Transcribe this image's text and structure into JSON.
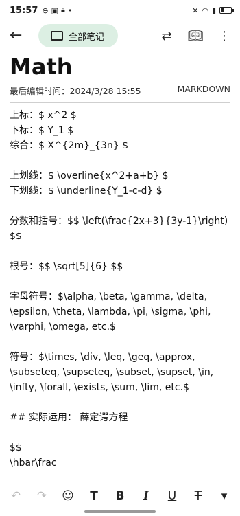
{
  "status_bar": {
    "time": "15:57"
  },
  "app_bar": {
    "folder_label": "全部笔记"
  },
  "note": {
    "title": "Math",
    "last_edited": "最后编辑时间：2024/3/28 15:55",
    "mode": "MARKDOWN",
    "lines": [
      "上标：$ x^2 $",
      "下标：$ Y_1 $",
      "综合：$ X^{2m}_{3n} $",
      "",
      "上划线：$ \\overline{x^2+a+b} $",
      "下划线：$ \\underline{Y_1-c-d} $",
      "",
      "分数和括号：$$ \\left(\\frac{2x+3}{3y-1}\\right) $$",
      "",
      "根号：$$ \\sqrt[5]{6} $$",
      "",
      "字母符号：$\\alpha, \\beta, \\gamma, \\delta, \\epsilon, \\theta, \\lambda, \\pi, \\sigma, \\phi, \\varphi, \\omega, etc.$",
      "",
      "符号：$\\times, \\div, \\leq, \\geq, \\approx, \\subseteq, \\supseteq, \\subset, \\supset, \\in, \\infty, \\forall, \\exists, \\sum, \\lim, etc.$",
      "",
      "## 实际运用： 薛定谔方程",
      "",
      "$$",
      "\\hbar\\frac"
    ]
  },
  "toolbar": {
    "undo_icon": "undo-icon",
    "redo_icon": "redo-icon",
    "emoji_icon": "emoji-icon",
    "heading_label": "T",
    "bold_label": "B",
    "italic_label": "I",
    "underline_label": "U",
    "strike_label": "T"
  }
}
